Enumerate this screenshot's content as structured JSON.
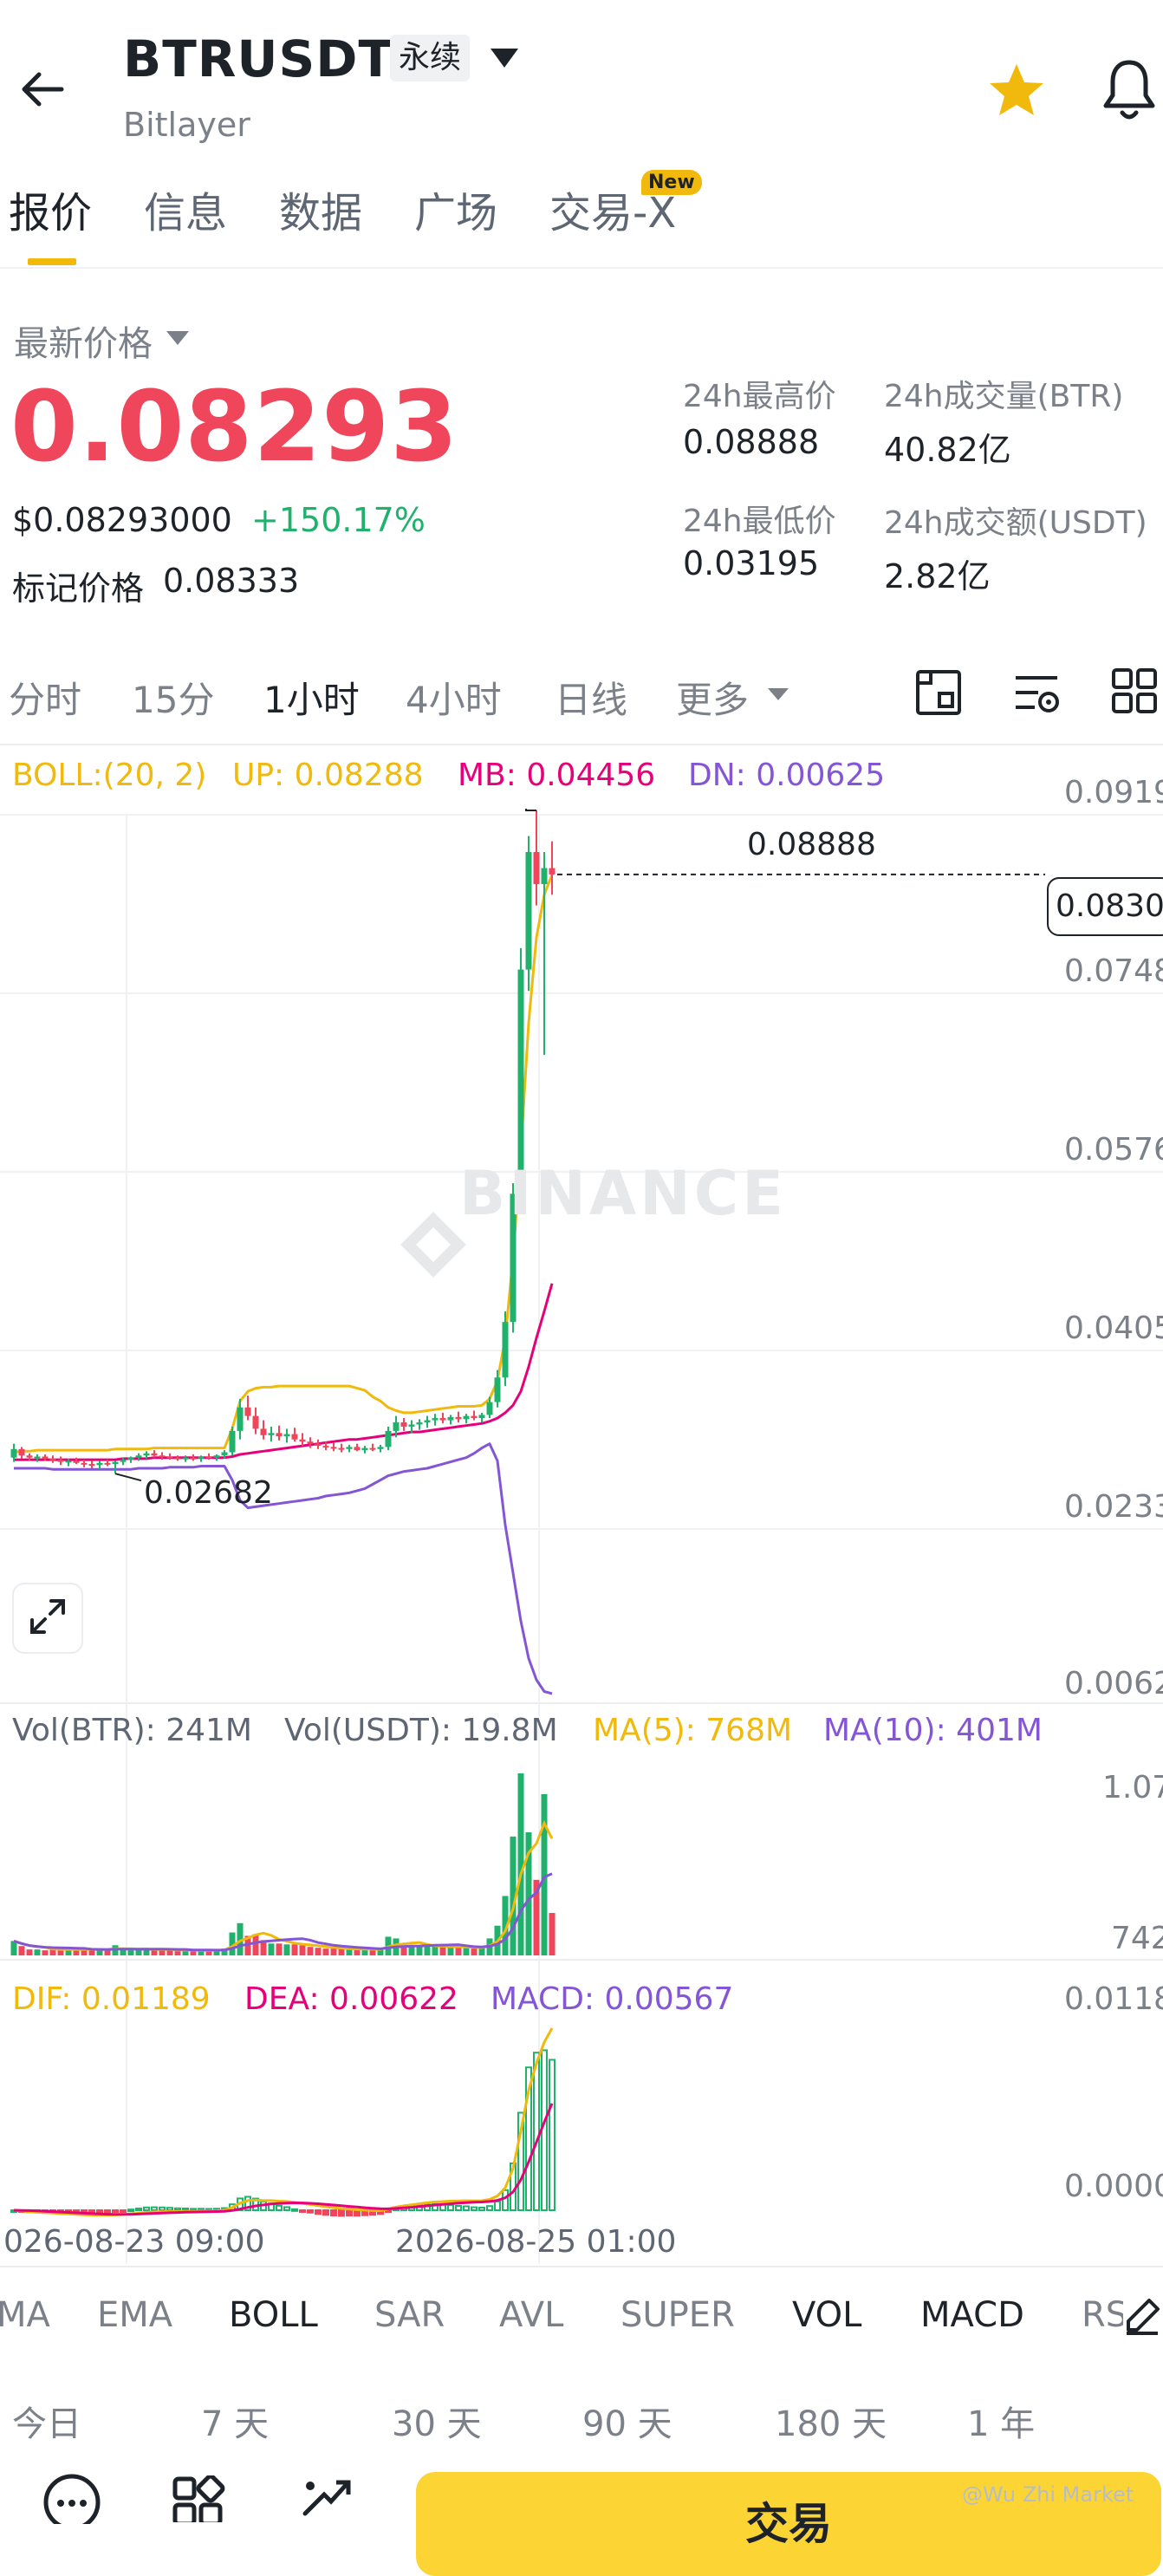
{
  "header": {
    "symbol": "BTRUSDT",
    "contract_type": "永续",
    "exchange": "Bitlayer",
    "icons": [
      "back-arrow-icon",
      "chevron-down-icon",
      "star-icon",
      "bell-icon"
    ],
    "star_color": "#f0b90b"
  },
  "tabs": [
    {
      "label": "报价",
      "active": true
    },
    {
      "label": "信息"
    },
    {
      "label": "数据"
    },
    {
      "label": "广场"
    },
    {
      "label": "交易-X",
      "badge": "New"
    }
  ],
  "price": {
    "label": "最新价格",
    "last": "0.08293",
    "usd": "$0.08293000",
    "change_pct": "+150.17%",
    "mark_label": "标记价格",
    "mark_value": "0.08333",
    "up_color": "#20b26c",
    "down_color": "#f0465c"
  },
  "stats": [
    {
      "label": "24h最高价",
      "value": "0.08888"
    },
    {
      "label": "24h成交量(BTR)",
      "value": "40.82亿"
    },
    {
      "label": "24h最低价",
      "value": "0.03195"
    },
    {
      "label": "24h成交额(USDT)",
      "value": "2.82亿"
    }
  ],
  "timeframes": [
    {
      "label": "分时"
    },
    {
      "label": "15分"
    },
    {
      "label": "1小时",
      "active": true
    },
    {
      "label": "4小时"
    },
    {
      "label": "日线"
    },
    {
      "label": "更多"
    }
  ],
  "tools": [
    "depth-chart-icon",
    "chart-settings-icon",
    "grid-layout-icon"
  ],
  "boll_legend": {
    "name": "BOLL:(20, 2)",
    "up": "UP: 0.08288",
    "mb": "MB: 0.04456",
    "dn": "DN: 0.00625"
  },
  "chart_data": {
    "type": "candlestick",
    "interval": "1小时",
    "y_ticks": [
      "0.0919",
      "0.0748",
      "0.0576",
      "0.0405",
      "0.0233",
      "0.0062"
    ],
    "ylim": [
      0.0062,
      0.0919
    ],
    "high_label": "0.08888",
    "low_label": "0.02682",
    "current_price_tag": "0.0830",
    "watermark": "BINANCE",
    "x_ticks": [
      "026-08-23 09:00",
      "2026-08-25 01:00"
    ],
    "candles": [
      [
        0.0283,
        0.0296,
        0.0279,
        0.0291
      ],
      [
        0.0291,
        0.0293,
        0.0282,
        0.0285
      ],
      [
        0.0285,
        0.0287,
        0.028,
        0.0283
      ],
      [
        0.0283,
        0.0286,
        0.0279,
        0.0284
      ],
      [
        0.0284,
        0.0286,
        0.028,
        0.0282
      ],
      [
        0.0282,
        0.0285,
        0.0278,
        0.0281
      ],
      [
        0.0281,
        0.0284,
        0.0276,
        0.0279
      ],
      [
        0.0279,
        0.0282,
        0.0275,
        0.028
      ],
      [
        0.028,
        0.0283,
        0.0277,
        0.0278
      ],
      [
        0.0278,
        0.0281,
        0.0274,
        0.0277
      ],
      [
        0.0277,
        0.028,
        0.0273,
        0.0276
      ],
      [
        0.0276,
        0.028,
        0.0272,
        0.0278
      ],
      [
        0.0278,
        0.0281,
        0.0275,
        0.0277
      ],
      [
        0.0277,
        0.028,
        0.0268,
        0.0279
      ],
      [
        0.0279,
        0.0283,
        0.0276,
        0.0281
      ],
      [
        0.0281,
        0.0284,
        0.0278,
        0.0283
      ],
      [
        0.0283,
        0.0287,
        0.028,
        0.0285
      ],
      [
        0.0285,
        0.0289,
        0.0282,
        0.0287
      ],
      [
        0.0287,
        0.029,
        0.0283,
        0.0285
      ],
      [
        0.0285,
        0.0288,
        0.0281,
        0.0284
      ],
      [
        0.0284,
        0.0287,
        0.0281,
        0.0283
      ],
      [
        0.0283,
        0.0285,
        0.028,
        0.0282
      ],
      [
        0.0282,
        0.0285,
        0.0279,
        0.0283
      ],
      [
        0.0283,
        0.0286,
        0.028,
        0.0282
      ],
      [
        0.0282,
        0.0285,
        0.0279,
        0.0284
      ],
      [
        0.0284,
        0.0287,
        0.0281,
        0.0283
      ],
      [
        0.0283,
        0.0286,
        0.028,
        0.0285
      ],
      [
        0.0285,
        0.029,
        0.0282,
        0.0288
      ],
      [
        0.0288,
        0.0312,
        0.0285,
        0.0308
      ],
      [
        0.0308,
        0.0338,
        0.03,
        0.033
      ],
      [
        0.033,
        0.0341,
        0.0318,
        0.0322
      ],
      [
        0.0322,
        0.033,
        0.0305,
        0.031
      ],
      [
        0.031,
        0.0318,
        0.03,
        0.0304
      ],
      [
        0.0304,
        0.0312,
        0.0298,
        0.0306
      ],
      [
        0.0306,
        0.0313,
        0.0299,
        0.0303
      ],
      [
        0.0303,
        0.031,
        0.0297,
        0.0305
      ],
      [
        0.0305,
        0.0311,
        0.0298,
        0.03
      ],
      [
        0.03,
        0.0306,
        0.0294,
        0.0298
      ],
      [
        0.0298,
        0.0302,
        0.0292,
        0.0296
      ],
      [
        0.0296,
        0.03,
        0.0291,
        0.0294
      ],
      [
        0.0294,
        0.0298,
        0.029,
        0.0293
      ],
      [
        0.0293,
        0.0297,
        0.0289,
        0.0292
      ],
      [
        0.0292,
        0.0296,
        0.0288,
        0.0291
      ],
      [
        0.0291,
        0.0295,
        0.0288,
        0.0293
      ],
      [
        0.0293,
        0.0296,
        0.0289,
        0.029
      ],
      [
        0.029,
        0.0294,
        0.0287,
        0.0292
      ],
      [
        0.0292,
        0.0296,
        0.0289,
        0.0291
      ],
      [
        0.0291,
        0.0295,
        0.0288,
        0.0293
      ],
      [
        0.0293,
        0.0312,
        0.029,
        0.0308
      ],
      [
        0.0308,
        0.0322,
        0.0302,
        0.0316
      ],
      [
        0.0316,
        0.032,
        0.0308,
        0.0312
      ],
      [
        0.0312,
        0.0318,
        0.0306,
        0.0314
      ],
      [
        0.0314,
        0.0319,
        0.0309,
        0.0316
      ],
      [
        0.0316,
        0.0322,
        0.0311,
        0.0318
      ],
      [
        0.0318,
        0.0324,
        0.0313,
        0.032
      ],
      [
        0.032,
        0.0325,
        0.0315,
        0.0318
      ],
      [
        0.0318,
        0.0323,
        0.0314,
        0.0321
      ],
      [
        0.0321,
        0.0326,
        0.0316,
        0.0319
      ],
      [
        0.0319,
        0.0324,
        0.0315,
        0.0322
      ],
      [
        0.0322,
        0.0327,
        0.0318,
        0.032
      ],
      [
        0.032,
        0.0325,
        0.0316,
        0.0323
      ],
      [
        0.0323,
        0.034,
        0.032,
        0.0335
      ],
      [
        0.0335,
        0.0365,
        0.033,
        0.0358
      ],
      [
        0.0358,
        0.042,
        0.035,
        0.041
      ],
      [
        0.041,
        0.054,
        0.04,
        0.053
      ],
      [
        0.053,
        0.076,
        0.052,
        0.074
      ],
      [
        0.074,
        0.0865,
        0.072,
        0.085
      ],
      [
        0.085,
        0.0889,
        0.08,
        0.082
      ],
      [
        0.082,
        0.085,
        0.066,
        0.0835
      ],
      [
        0.0835,
        0.086,
        0.081,
        0.0829
      ]
    ],
    "boll_up": [
      0.0288,
      0.0289,
      0.0289,
      0.029,
      0.029,
      0.029,
      0.029,
      0.029,
      0.029,
      0.029,
      0.029,
      0.029,
      0.029,
      0.0291,
      0.0291,
      0.0291,
      0.0291,
      0.0291,
      0.0292,
      0.0292,
      0.0292,
      0.0292,
      0.0292,
      0.0292,
      0.0292,
      0.0292,
      0.0292,
      0.0292,
      0.031,
      0.0336,
      0.0345,
      0.0348,
      0.0349,
      0.0349,
      0.035,
      0.035,
      0.035,
      0.035,
      0.035,
      0.035,
      0.035,
      0.035,
      0.035,
      0.035,
      0.0348,
      0.0346,
      0.034,
      0.0336,
      0.033,
      0.0327,
      0.0325,
      0.0325,
      0.0326,
      0.0327,
      0.0328,
      0.0329,
      0.033,
      0.0331,
      0.0331,
      0.0331,
      0.0332,
      0.0338,
      0.0355,
      0.0395,
      0.047,
      0.057,
      0.069,
      0.077,
      0.081,
      0.0829
    ],
    "boll_mb": [
      0.0281,
      0.0281,
      0.0281,
      0.0281,
      0.0281,
      0.0281,
      0.0281,
      0.0281,
      0.0281,
      0.0281,
      0.0281,
      0.0281,
      0.0281,
      0.0281,
      0.0282,
      0.0282,
      0.0282,
      0.0282,
      0.0283,
      0.0283,
      0.0283,
      0.0283,
      0.0283,
      0.0283,
      0.0283,
      0.0283,
      0.0283,
      0.0283,
      0.0284,
      0.0286,
      0.0287,
      0.0288,
      0.0289,
      0.029,
      0.0291,
      0.0292,
      0.0293,
      0.0294,
      0.0295,
      0.0296,
      0.0297,
      0.0298,
      0.0299,
      0.03,
      0.03,
      0.0301,
      0.0302,
      0.0303,
      0.0304,
      0.0305,
      0.0306,
      0.0307,
      0.0307,
      0.0308,
      0.0309,
      0.031,
      0.0311,
      0.0312,
      0.0313,
      0.0314,
      0.0315,
      0.0317,
      0.032,
      0.0325,
      0.0332,
      0.0345,
      0.0368,
      0.0395,
      0.042,
      0.0446
    ],
    "boll_dn": [
      0.0273,
      0.0273,
      0.0273,
      0.0273,
      0.0273,
      0.0272,
      0.0272,
      0.0272,
      0.0272,
      0.0272,
      0.0272,
      0.0272,
      0.0272,
      0.0272,
      0.0272,
      0.0272,
      0.0273,
      0.0273,
      0.0273,
      0.0273,
      0.0274,
      0.0274,
      0.0274,
      0.0274,
      0.0275,
      0.0275,
      0.0275,
      0.0275,
      0.0262,
      0.0243,
      0.0236,
      0.0237,
      0.0238,
      0.0239,
      0.024,
      0.0241,
      0.0242,
      0.0243,
      0.0244,
      0.0245,
      0.0247,
      0.0248,
      0.0249,
      0.025,
      0.0252,
      0.0254,
      0.0258,
      0.0262,
      0.0266,
      0.0268,
      0.027,
      0.0271,
      0.0272,
      0.0273,
      0.0275,
      0.0277,
      0.0279,
      0.0281,
      0.0283,
      0.0287,
      0.0292,
      0.0296,
      0.028,
      0.022,
      0.0175,
      0.013,
      0.0095,
      0.0075,
      0.0064,
      0.0062
    ]
  },
  "vol_legend": {
    "btr": "Vol(BTR): 241M",
    "usdt": "Vol(USDT): 19.8M",
    "ma5": "MA(5): 768M",
    "ma10": "MA(10): 401M",
    "y_top": "1.07",
    "y_bottom": "742"
  },
  "macd_legend": {
    "dif": "DIF: 0.01189",
    "dea": "DEA: 0.00622",
    "macd": "MACD: 0.00567",
    "y_top": "0.0118",
    "y_bottom": "0.0000"
  },
  "indicators": [
    {
      "label": "MA"
    },
    {
      "label": "EMA"
    },
    {
      "label": "BOLL",
      "active": true
    },
    {
      "label": "SAR"
    },
    {
      "label": "AVL"
    },
    {
      "label": "SUPER"
    },
    {
      "label": "VOL",
      "active": true
    },
    {
      "label": "MACD",
      "active": true
    },
    {
      "label": "RS"
    }
  ],
  "ranges": [
    "今日",
    "7 天",
    "30 天",
    "90 天",
    "180 天",
    "1 年"
  ],
  "bottom": {
    "trade_label": "交易",
    "icons": [
      "chat-icon",
      "apps-icon",
      "trading-bot-icon"
    ],
    "watermark": "@Wu Zhi Market"
  }
}
